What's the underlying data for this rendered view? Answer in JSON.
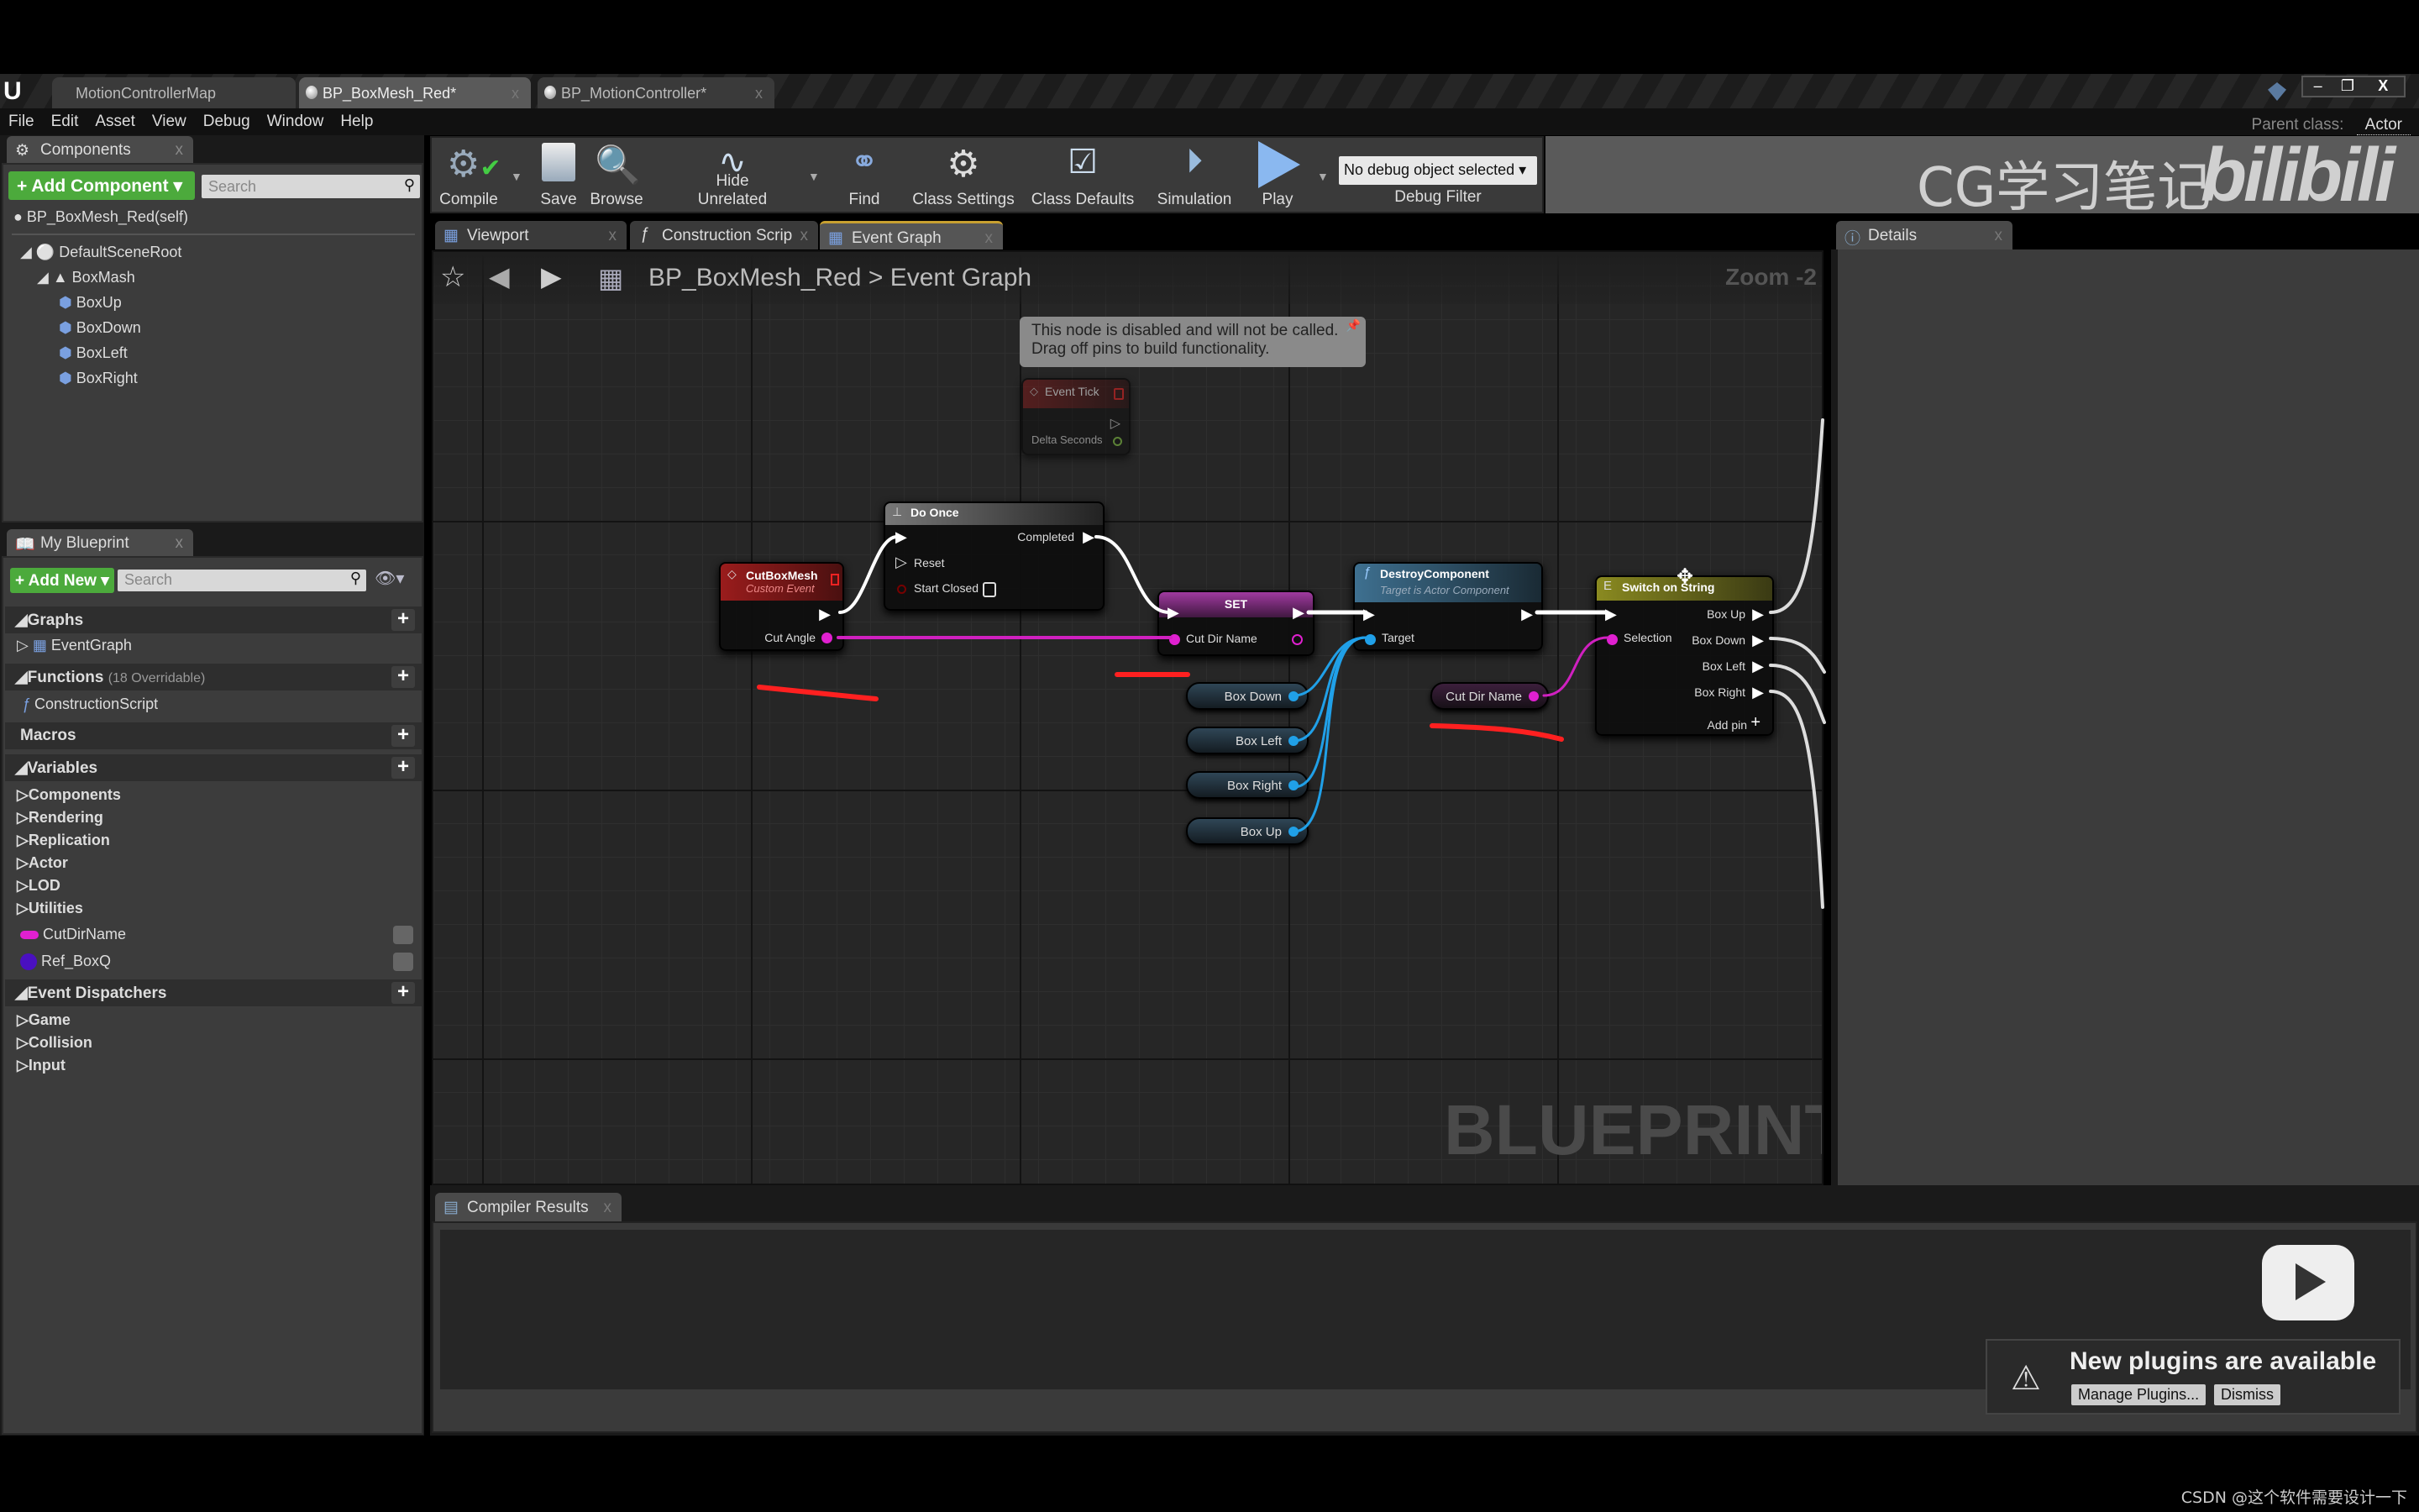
{
  "doc_tabs": [
    "MotionControllerMap",
    "BP_BoxMesh_Red*",
    "BP_MotionController*"
  ],
  "menu": [
    "File",
    "Edit",
    "Asset",
    "View",
    "Debug",
    "Window",
    "Help"
  ],
  "parent_class": {
    "label": "Parent class:",
    "value": "Actor"
  },
  "watermark": {
    "text": "CG学习笔记",
    "logo": "bilibili"
  },
  "components": {
    "tab": "Components",
    "add_label": "Add Component",
    "search_placeholder": "Search",
    "self": "BP_BoxMesh_Red(self)",
    "tree": [
      "DefaultSceneRoot",
      "BoxMash",
      "BoxUp",
      "BoxDown",
      "BoxLeft",
      "BoxRight"
    ]
  },
  "my_blueprint": {
    "tab": "My Blueprint",
    "add_label": "Add New",
    "search_placeholder": "Search",
    "graphs": "Graphs",
    "event_graph": "EventGraph",
    "functions": "Functions",
    "functions_note": "(18 Overridable)",
    "construction": "ConstructionScript",
    "macros": "Macros",
    "variables": "Variables",
    "var_categories": [
      "Components",
      "Rendering",
      "Replication",
      "Actor",
      "LOD",
      "Utilities"
    ],
    "vars": [
      {
        "name": "CutDirName",
        "color": "#e020d0"
      },
      {
        "name": "Ref_BoxQ",
        "color": "#4a10c0"
      }
    ],
    "dispatchers": "Event Dispatchers",
    "disp_categories": [
      "Game",
      "Collision",
      "Input"
    ]
  },
  "toolbar": {
    "items": [
      "Compile",
      "Save",
      "Browse",
      "Hide Unrelated",
      "Find",
      "Class Settings",
      "Class Defaults",
      "Simulation",
      "Play"
    ],
    "debug_select": "No debug object selected",
    "debug_label": "Debug Filter"
  },
  "graph_tabs": [
    "Viewport",
    "Construction Scrip",
    "Event Graph"
  ],
  "breadcrumb": {
    "bp": "BP_BoxMesh_Red",
    "graph": "Event Graph",
    "zoom": "Zoom -2"
  },
  "comment": {
    "line1": "This node is disabled and will not be called.",
    "line2": "Drag off pins to build functionality."
  },
  "nodes": {
    "event_tick": {
      "title": "Event Tick",
      "pin": "Delta Seconds"
    },
    "cutboxmesh": {
      "title": "CutBoxMesh",
      "sub": "Custom Event",
      "pin": "Cut Angle"
    },
    "doonce": {
      "title": "Do Once",
      "completed": "Completed",
      "reset": "Reset",
      "start_closed": "Start Closed"
    },
    "set": {
      "title": "SET",
      "pin": "Cut Dir Name"
    },
    "destroy": {
      "title": "DestroyComponent",
      "sub": "Target is Actor Component",
      "pin": "Target"
    },
    "switch": {
      "title": "Switch on String",
      "selection": "Selection",
      "outs": [
        "Box Up",
        "Box Down",
        "Box Left",
        "Box Right"
      ],
      "add_pin": "Add pin"
    },
    "vars": [
      "Box Down",
      "Box Left",
      "Box Right",
      "Box Up"
    ],
    "cutdir_var": "Cut Dir Name"
  },
  "graph_watermark": "BLUEPRINT",
  "details": {
    "tab": "Details"
  },
  "compiler": {
    "tab": "Compiler Results"
  },
  "notification": {
    "text": "New plugins are available",
    "manage": "Manage Plugins...",
    "dismiss": "Dismiss"
  },
  "footer": "CSDN @这个软件需要设计一下",
  "colors": {
    "exec": "#ffffff",
    "string_pin": "#e020d0",
    "object_pin": "#20a0e8",
    "event_header": "#8c1a1a",
    "function_header": "#3a6a88",
    "switch_header": "#7a7a20",
    "annotation": "#ff2020"
  }
}
